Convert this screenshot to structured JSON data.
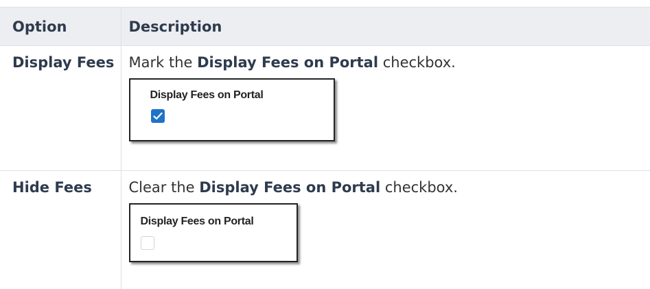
{
  "table": {
    "headers": [
      "Option",
      "Description"
    ],
    "rows": [
      {
        "option": "Display Fees",
        "desc_prefix": "Mark the ",
        "desc_bold": "Display Fees on Portal",
        "desc_suffix": " checkbox.",
        "screenshot_label": "Display Fees on Portal",
        "checkbox_state": "checked"
      },
      {
        "option": "Hide Fees",
        "desc_prefix": "Clear the ",
        "desc_bold": "Display Fees on Portal",
        "desc_suffix": " checkbox.",
        "screenshot_label": "Display Fees on Portal",
        "checkbox_state": "unchecked"
      }
    ]
  },
  "colors": {
    "header_bg": "#edeef1",
    "heading_text": "#2e3b4e",
    "checkbox_checked": "#1e73c8"
  }
}
